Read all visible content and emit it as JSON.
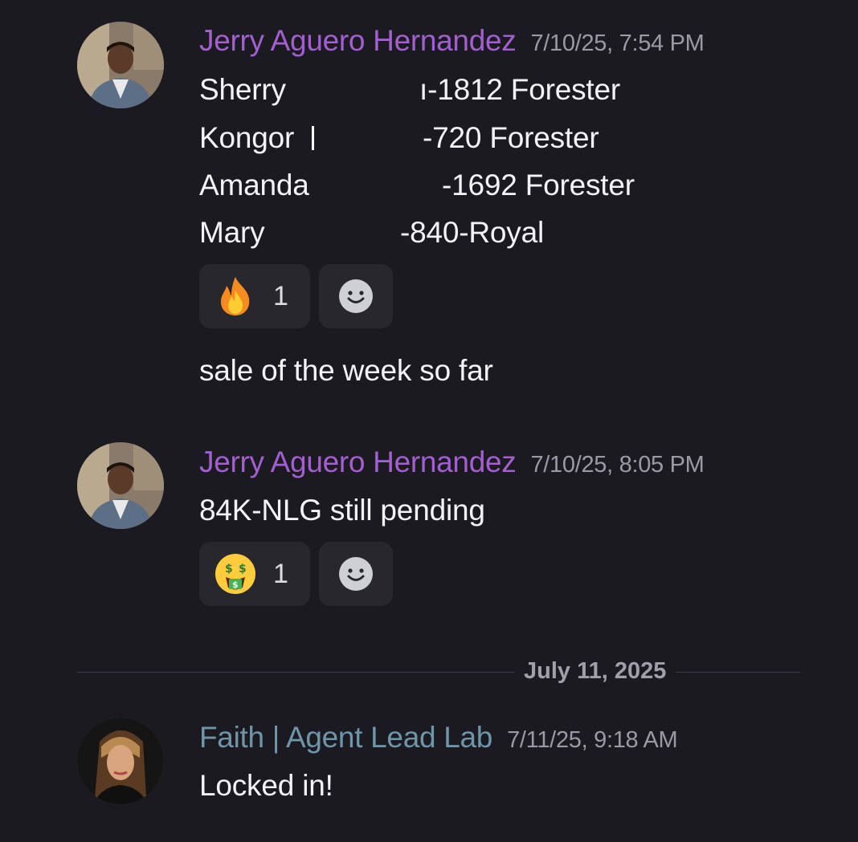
{
  "messages": [
    {
      "author": "Jerry Aguero Hernandez",
      "timestamp": "7/10/25, 7:54 PM",
      "lines": [
        {
          "name": "Sherry",
          "detail": "ı-1812 Forester"
        },
        {
          "name": "Kongor",
          "detail": "-720 Forester"
        },
        {
          "name": "Amanda",
          "detail": "-1692 Forester"
        },
        {
          "name": "Mary",
          "detail": "-840-Royal"
        }
      ],
      "reaction": {
        "emoji": "fire",
        "count": "1"
      },
      "followup": "sale of the week so far"
    },
    {
      "author": "Jerry Aguero Hernandez",
      "timestamp": "7/10/25, 8:05 PM",
      "text": "84K-NLG still pending",
      "reaction": {
        "emoji": "money-mouth-face",
        "count": "1"
      }
    },
    {
      "author": "Faith | Agent Lead Lab",
      "timestamp": "7/11/25, 9:18 AM",
      "text": "Locked in!"
    }
  ],
  "date_divider": "July 11, 2025",
  "colors": {
    "background": "#1b1a20",
    "author_jerry": "#a35fd0",
    "author_faith": "#6f95a8",
    "timestamp": "#9a9ba2",
    "reaction_bg": "#27272d"
  },
  "icons": {
    "add_reaction": "smile-icon"
  }
}
